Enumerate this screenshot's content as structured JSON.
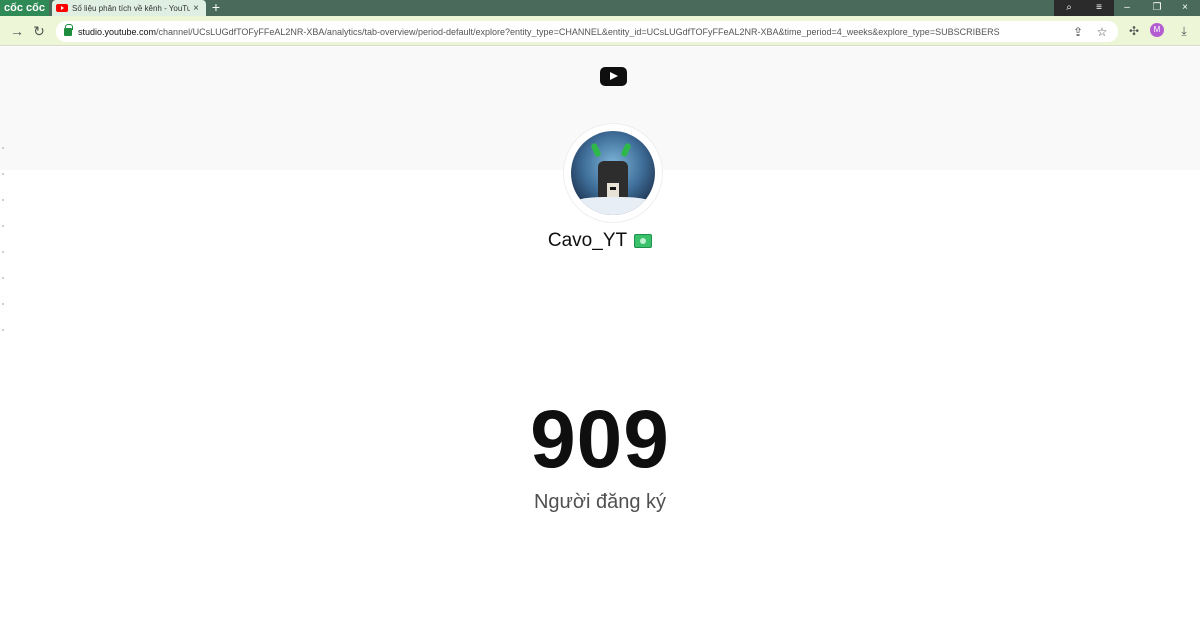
{
  "browser": {
    "brand": "cốc cốc",
    "tab": {
      "title": "Số liệu phân tích về kênh - YouTu"
    },
    "url": {
      "host": "studio.youtube.com",
      "path": "/channel/UCsLUGdfTOFyFFeAL2NR-XBA/analytics/tab-overview/period-default/explore?entity_type=CHANNEL&entity_id=UCsLUGdfTOFyFFeAL2NR-XBA&time_period=4_weeks&explore_type=SUBSCRIBERS"
    },
    "profile_initial": "M",
    "icons": {
      "back": "arrow-right-icon",
      "reload": "reload-icon",
      "share": "share-icon",
      "bookmark": "star-icon",
      "extensions": "puzzle-icon",
      "download": "download-icon"
    }
  },
  "page": {
    "channel_name": "Cavo_YT",
    "subscriber_count": "909",
    "subscriber_label": "Người đăng ký"
  },
  "colors": {
    "toolbar": "#edf7d8",
    "tabstrip": "#4a6b5c",
    "youtube_red": "#ff0000",
    "count_text": "#0f0f0f"
  }
}
